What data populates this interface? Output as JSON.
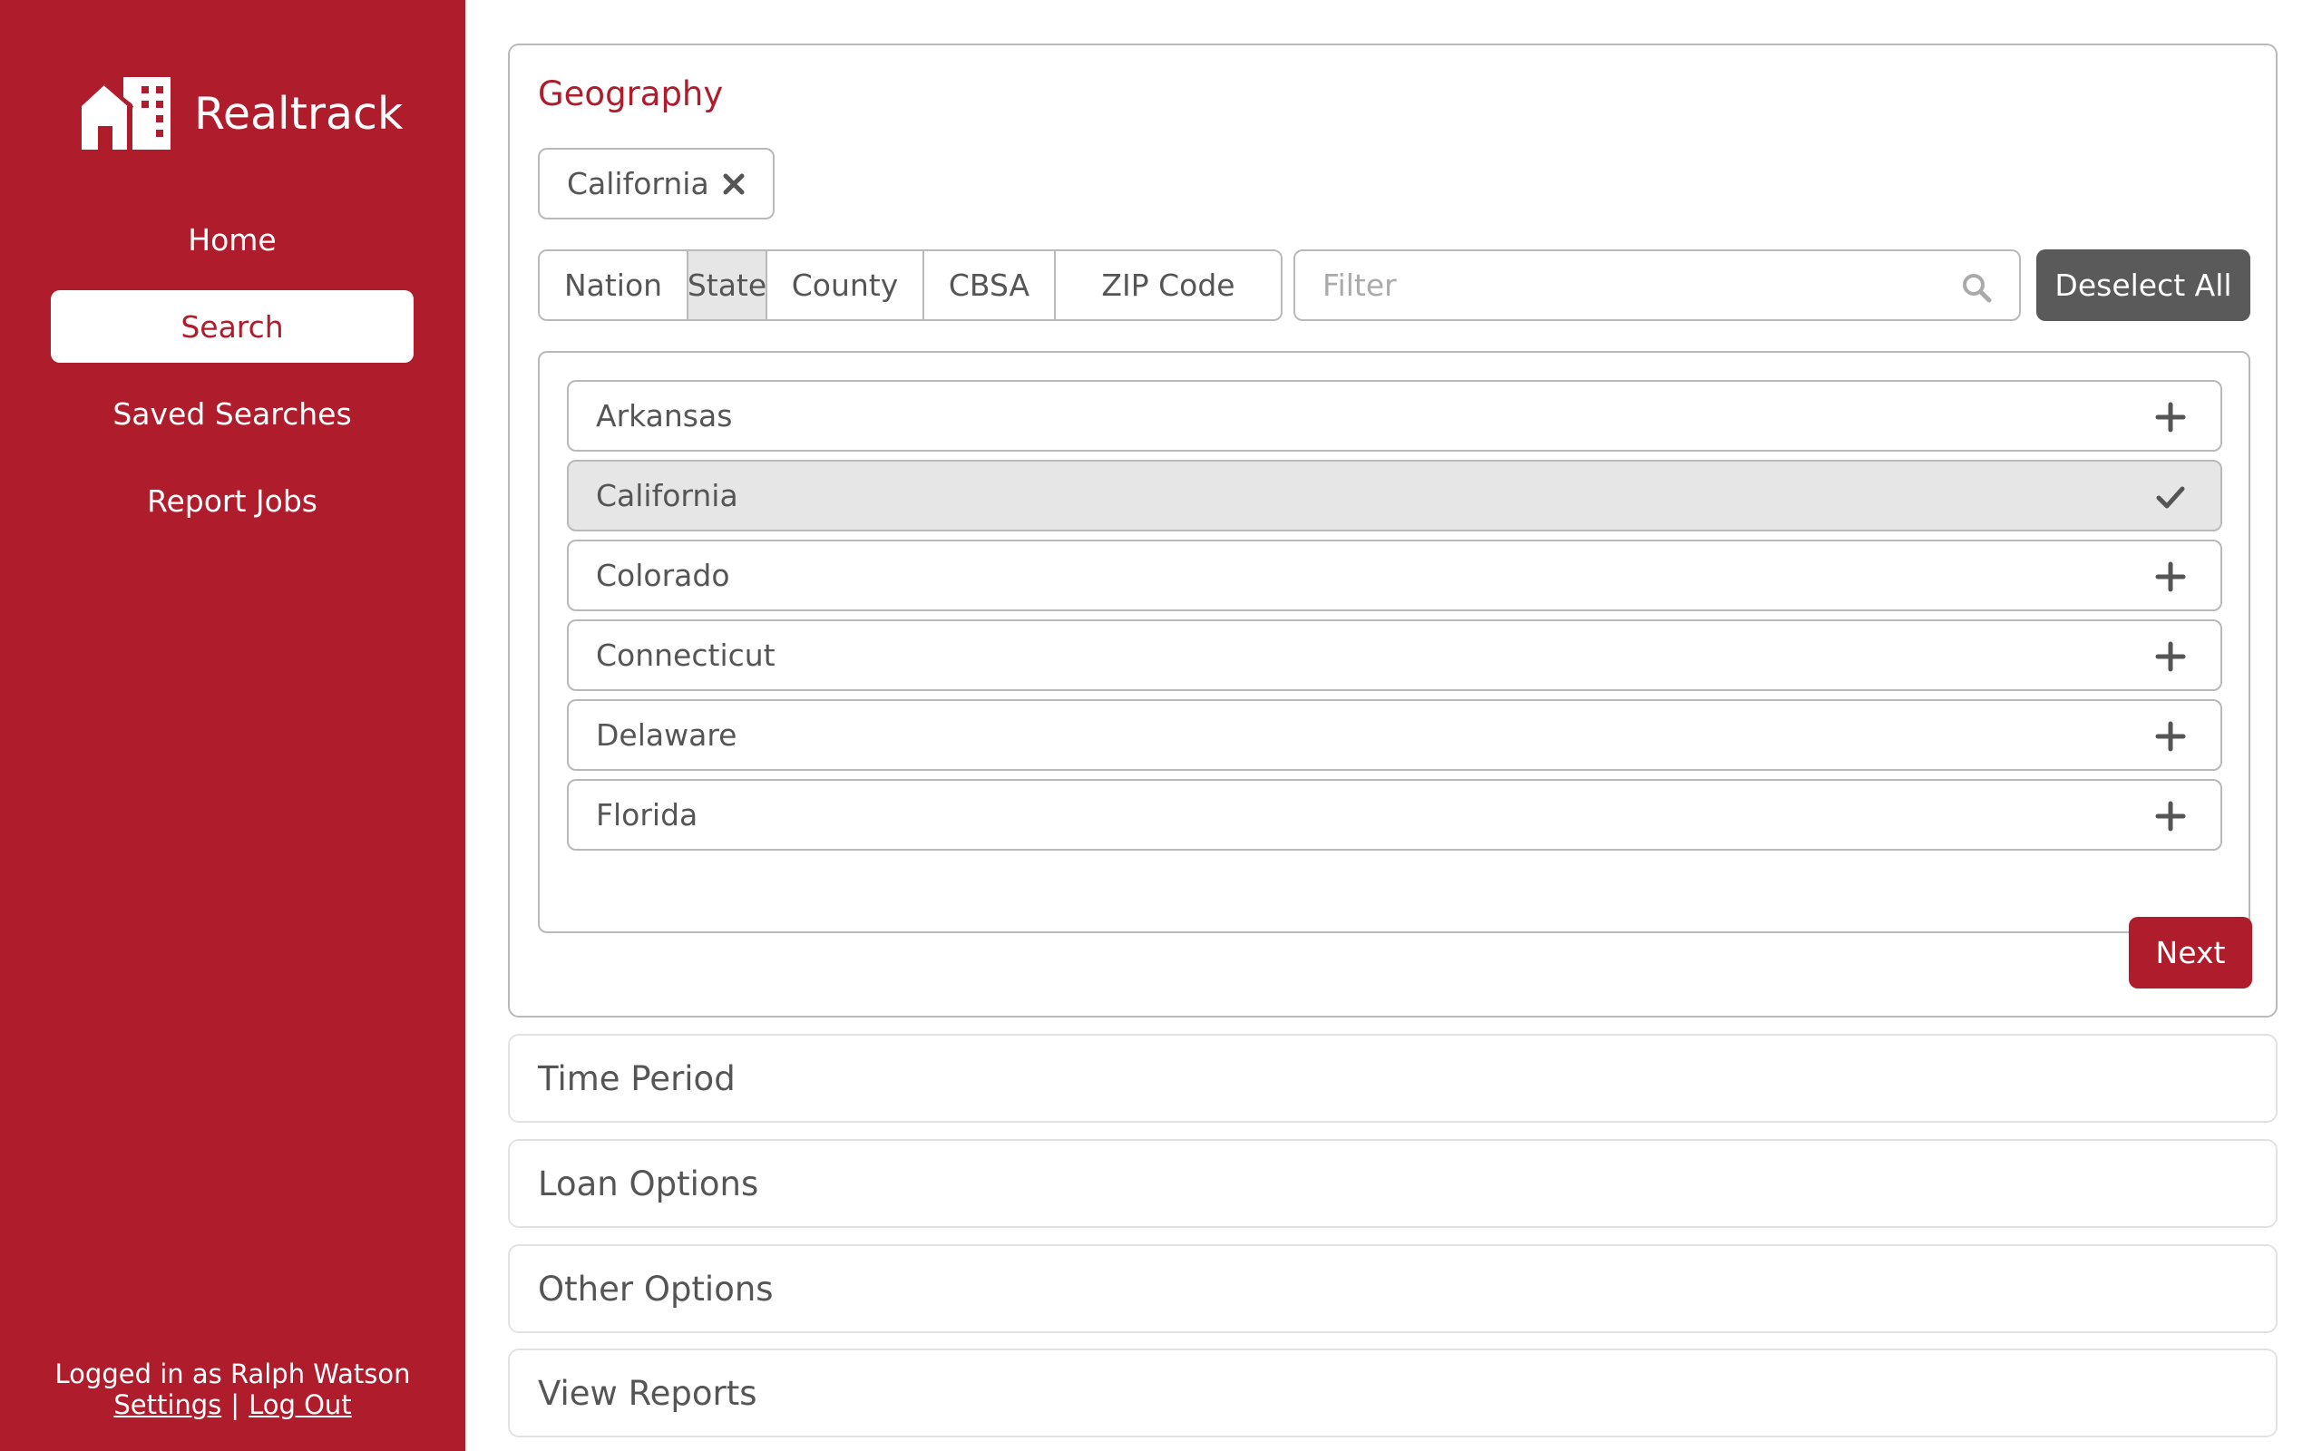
{
  "app": {
    "name": "Realtrack"
  },
  "sidebar": {
    "nav": [
      {
        "label": "Home",
        "active": false
      },
      {
        "label": "Search",
        "active": true
      },
      {
        "label": "Saved Searches",
        "active": false
      },
      {
        "label": "Report Jobs",
        "active": false
      }
    ],
    "footer": {
      "logged_in_text": "Logged in as Ralph Watson",
      "settings_label": "Settings",
      "separator": "|",
      "logout_label": "Log Out"
    }
  },
  "geography": {
    "title": "Geography",
    "selected_chip": "California",
    "levels": [
      "Nation",
      "State",
      "County",
      "CBSA",
      "ZIP Code"
    ],
    "active_level": "State",
    "filter": {
      "placeholder": "Filter",
      "value": ""
    },
    "deselect_label": "Deselect All",
    "items": [
      {
        "label": "Arkansas",
        "selected": false,
        "icon": "plus-icon"
      },
      {
        "label": "California",
        "selected": true,
        "icon": "check-icon"
      },
      {
        "label": "Colorado",
        "selected": false,
        "icon": "plus-icon"
      },
      {
        "label": "Connecticut",
        "selected": false,
        "icon": "plus-icon"
      },
      {
        "label": "Delaware",
        "selected": false,
        "icon": "plus-icon"
      },
      {
        "label": "Florida",
        "selected": false,
        "icon": "plus-icon"
      }
    ],
    "next_label": "Next"
  },
  "sections": [
    {
      "label": "Time Period"
    },
    {
      "label": "Loan Options"
    },
    {
      "label": "Other Options"
    },
    {
      "label": "View Reports"
    }
  ],
  "colors": {
    "brand_red": "#af1c2b",
    "dark_button": "#5a5a5a",
    "selected_bg": "#e6e6e6",
    "border": "#b9b9b9",
    "text": "#555555"
  }
}
